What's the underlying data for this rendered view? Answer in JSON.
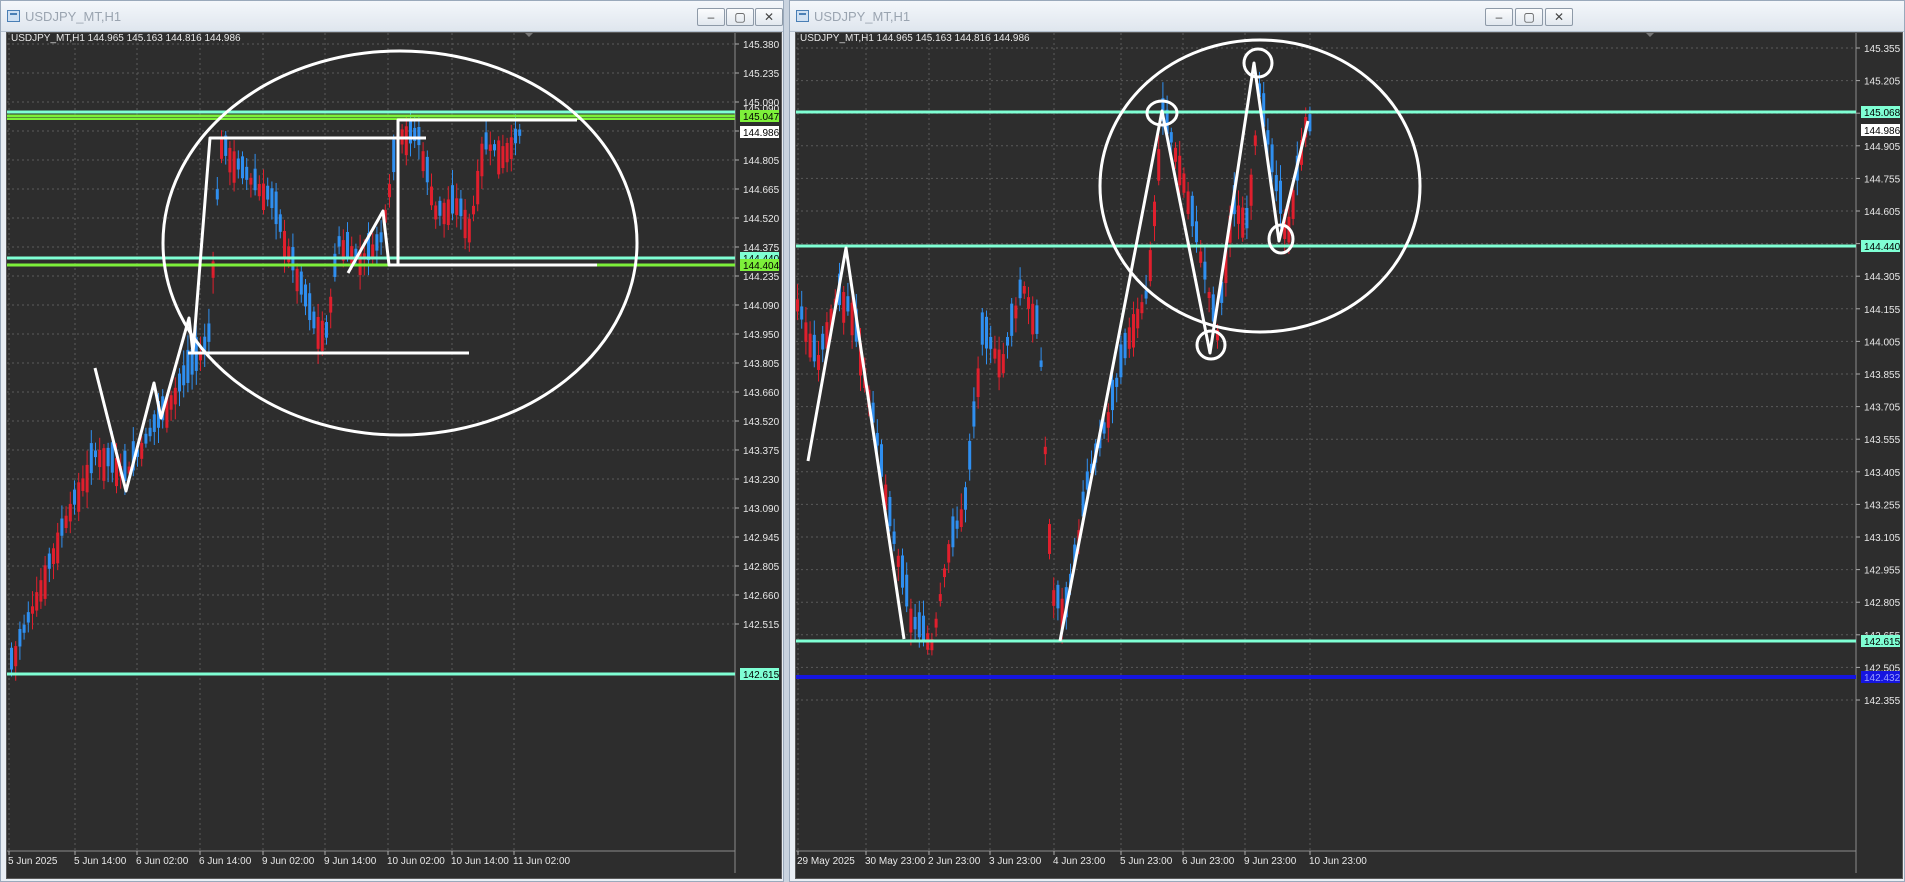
{
  "charts": [
    {
      "window_title": "USDJPY_MT,H1",
      "ohlc_line": "USDJPY_MT,H1  144.965 145.163 144.816 144.986",
      "price_labels": [
        "145.380",
        "145.235",
        "145.090",
        "144.950",
        "144.805",
        "144.665",
        "144.520",
        "144.375",
        "144.235",
        "144.090",
        "143.950",
        "143.805",
        "143.660",
        "143.520",
        "143.375",
        "143.230",
        "143.090",
        "142.945",
        "142.805",
        "142.660",
        "142.515"
      ],
      "time_labels": [
        "5 Jun 2025",
        "5 Jun 14:00",
        "6 Jun 02:00",
        "6 Jun 14:00",
        "9 Jun 02:00",
        "9 Jun 14:00",
        "10 Jun 02:00",
        "10 Jun 14:00",
        "11 Jun 02:00"
      ],
      "level_tags": [
        {
          "text": "145.047",
          "color": "#7df03a"
        },
        {
          "text": "144.986",
          "color": "#ffffff"
        },
        {
          "text": "144.440",
          "color": "#7fffd4"
        },
        {
          "text": "144.404",
          "color": "#7df03a"
        },
        {
          "text": "142.615",
          "color": "#7fffd4"
        }
      ],
      "hidden_tag": "145.090"
    },
    {
      "window_title": "USDJPY_MT,H1",
      "ohlc_line": "USDJPY_MT,H1  144.965 145.163 144.816 144.986",
      "price_labels": [
        "145.355",
        "145.205",
        "145.055",
        "144.905",
        "144.755",
        "144.605",
        "144.455",
        "144.305",
        "144.155",
        "144.005",
        "143.855",
        "143.705",
        "143.555",
        "143.405",
        "143.255",
        "143.105",
        "142.955",
        "142.805",
        "142.655",
        "142.505",
        "142.355"
      ],
      "time_labels": [
        "29 May 2025",
        "30 May 23:00",
        "2 Jun 23:00",
        "3 Jun 23:00",
        "4 Jun 23:00",
        "5 Jun 23:00",
        "6 Jun 23:00",
        "9 Jun 23:00",
        "10 Jun 23:00"
      ],
      "level_tags": [
        {
          "text": "145.068",
          "color": "#7fffd4"
        },
        {
          "text": "144.986",
          "color": "#ffffff"
        },
        {
          "text": "144.440",
          "color": "#7fffd4"
        },
        {
          "text": "142.615",
          "color": "#7fffd4"
        },
        {
          "text": "142.432",
          "color": "#1515e0"
        }
      ]
    }
  ],
  "colors": {
    "background": "#2d2d2d",
    "grid": "#5a5a5a",
    "bull": "#2f8ff0",
    "bear": "#e01f2d",
    "support": "#7fffd4",
    "green": "#7df03a",
    "blue": "#1515e0",
    "drawing": "#ffffff"
  }
}
